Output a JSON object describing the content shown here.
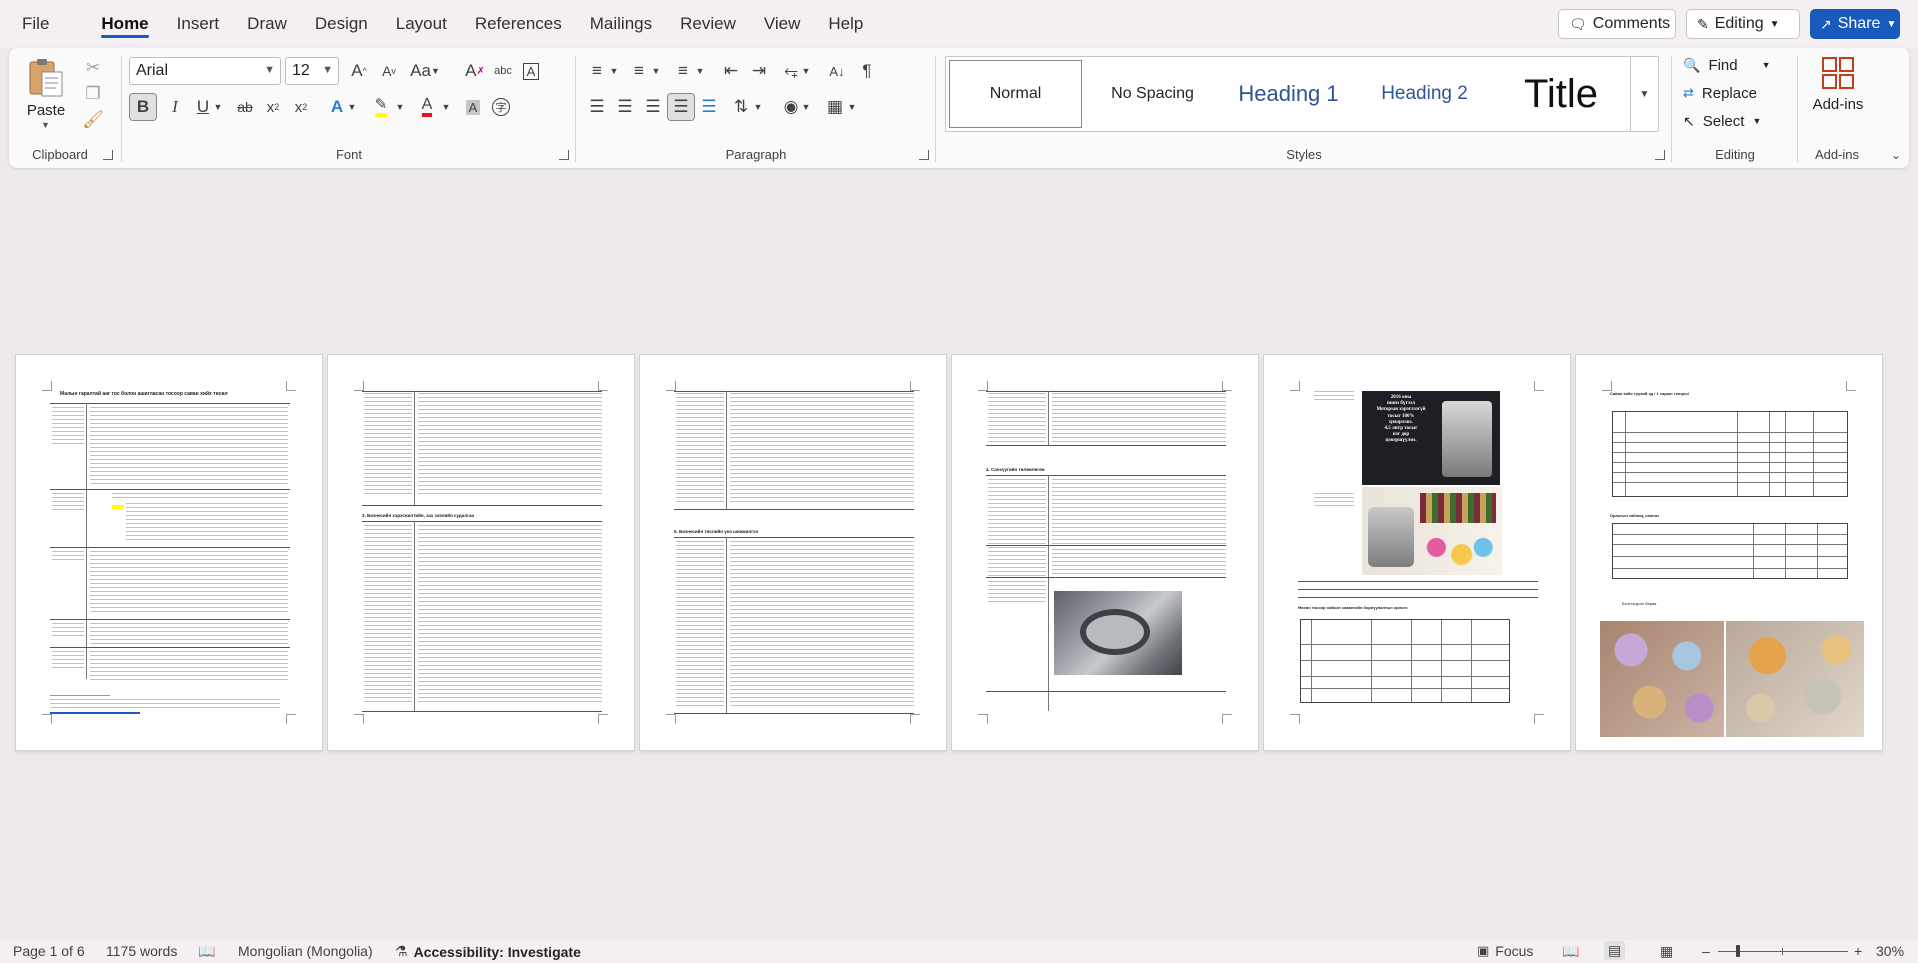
{
  "menu": {
    "tabs": [
      "File",
      "Home",
      "Insert",
      "Draw",
      "Design",
      "Layout",
      "References",
      "Mailings",
      "Review",
      "View",
      "Help"
    ],
    "active_tab": "Home",
    "comments_label": "Comments",
    "editing_label": "Editing",
    "share_label": "Share"
  },
  "ribbon": {
    "clipboard": {
      "paste_label": "Paste",
      "group_label": "Clipboard"
    },
    "font": {
      "font_name": "Arial",
      "font_size": "12",
      "group_label": "Font",
      "font_color": "#e81123",
      "highlight_color": "#ffff00"
    },
    "paragraph": {
      "group_label": "Paragraph"
    },
    "styles": {
      "group_label": "Styles",
      "items": [
        "Normal",
        "No Spacing",
        "Heading 1",
        "Heading 2",
        "Title"
      ],
      "selected": "Normal",
      "heading_color": "#2f5496"
    },
    "editing": {
      "find_label": "Find",
      "replace_label": "Replace",
      "select_label": "Select",
      "group_label": "Editing"
    },
    "addins": {
      "label": "Add-ins",
      "group_label": "Add-ins"
    }
  },
  "document": {
    "pages": [
      {
        "title": "Малын гаралтай ааг тос болон ашигласан тосоор саван хийх төсөл"
      },
      {
        "heading_1": "3. Бизнесийн хэрэгжилтийн, зах зээлийн судалгаа"
      },
      {
        "heading_1": "5. Бизнесийн төслийн үнэ шинжилгээ"
      },
      {
        "heading_1": "4. Санхүүгийн төлөвлөгөө"
      },
      {
        "banner_lines": [
          "2016 оны",
          "шинэ бүтээл",
          "Моторын хэрэглээгүй",
          "тосыг 100%",
          "цэвэрлэнэ.",
          "4.5 литр тосыг",
          "нэг дор",
          "цэвэршүүлнэ."
        ],
        "table_title": "Өөхөн тосоор хийсэн савангийн борлуулалтын орлого"
      },
      {
        "title": "Саван хийх түүхий эд / 1 сарын тооцоо/",
        "table_title": "Орлогын таблиц, сая/төг",
        "caption": "Бэлтгэгдсэн бараа"
      }
    ]
  },
  "status": {
    "page": "Page 1 of 6",
    "words": "1175 words",
    "language": "Mongolian (Mongolia)",
    "accessibility": "Accessibility: Investigate",
    "focus": "Focus",
    "zoom": "30%"
  }
}
